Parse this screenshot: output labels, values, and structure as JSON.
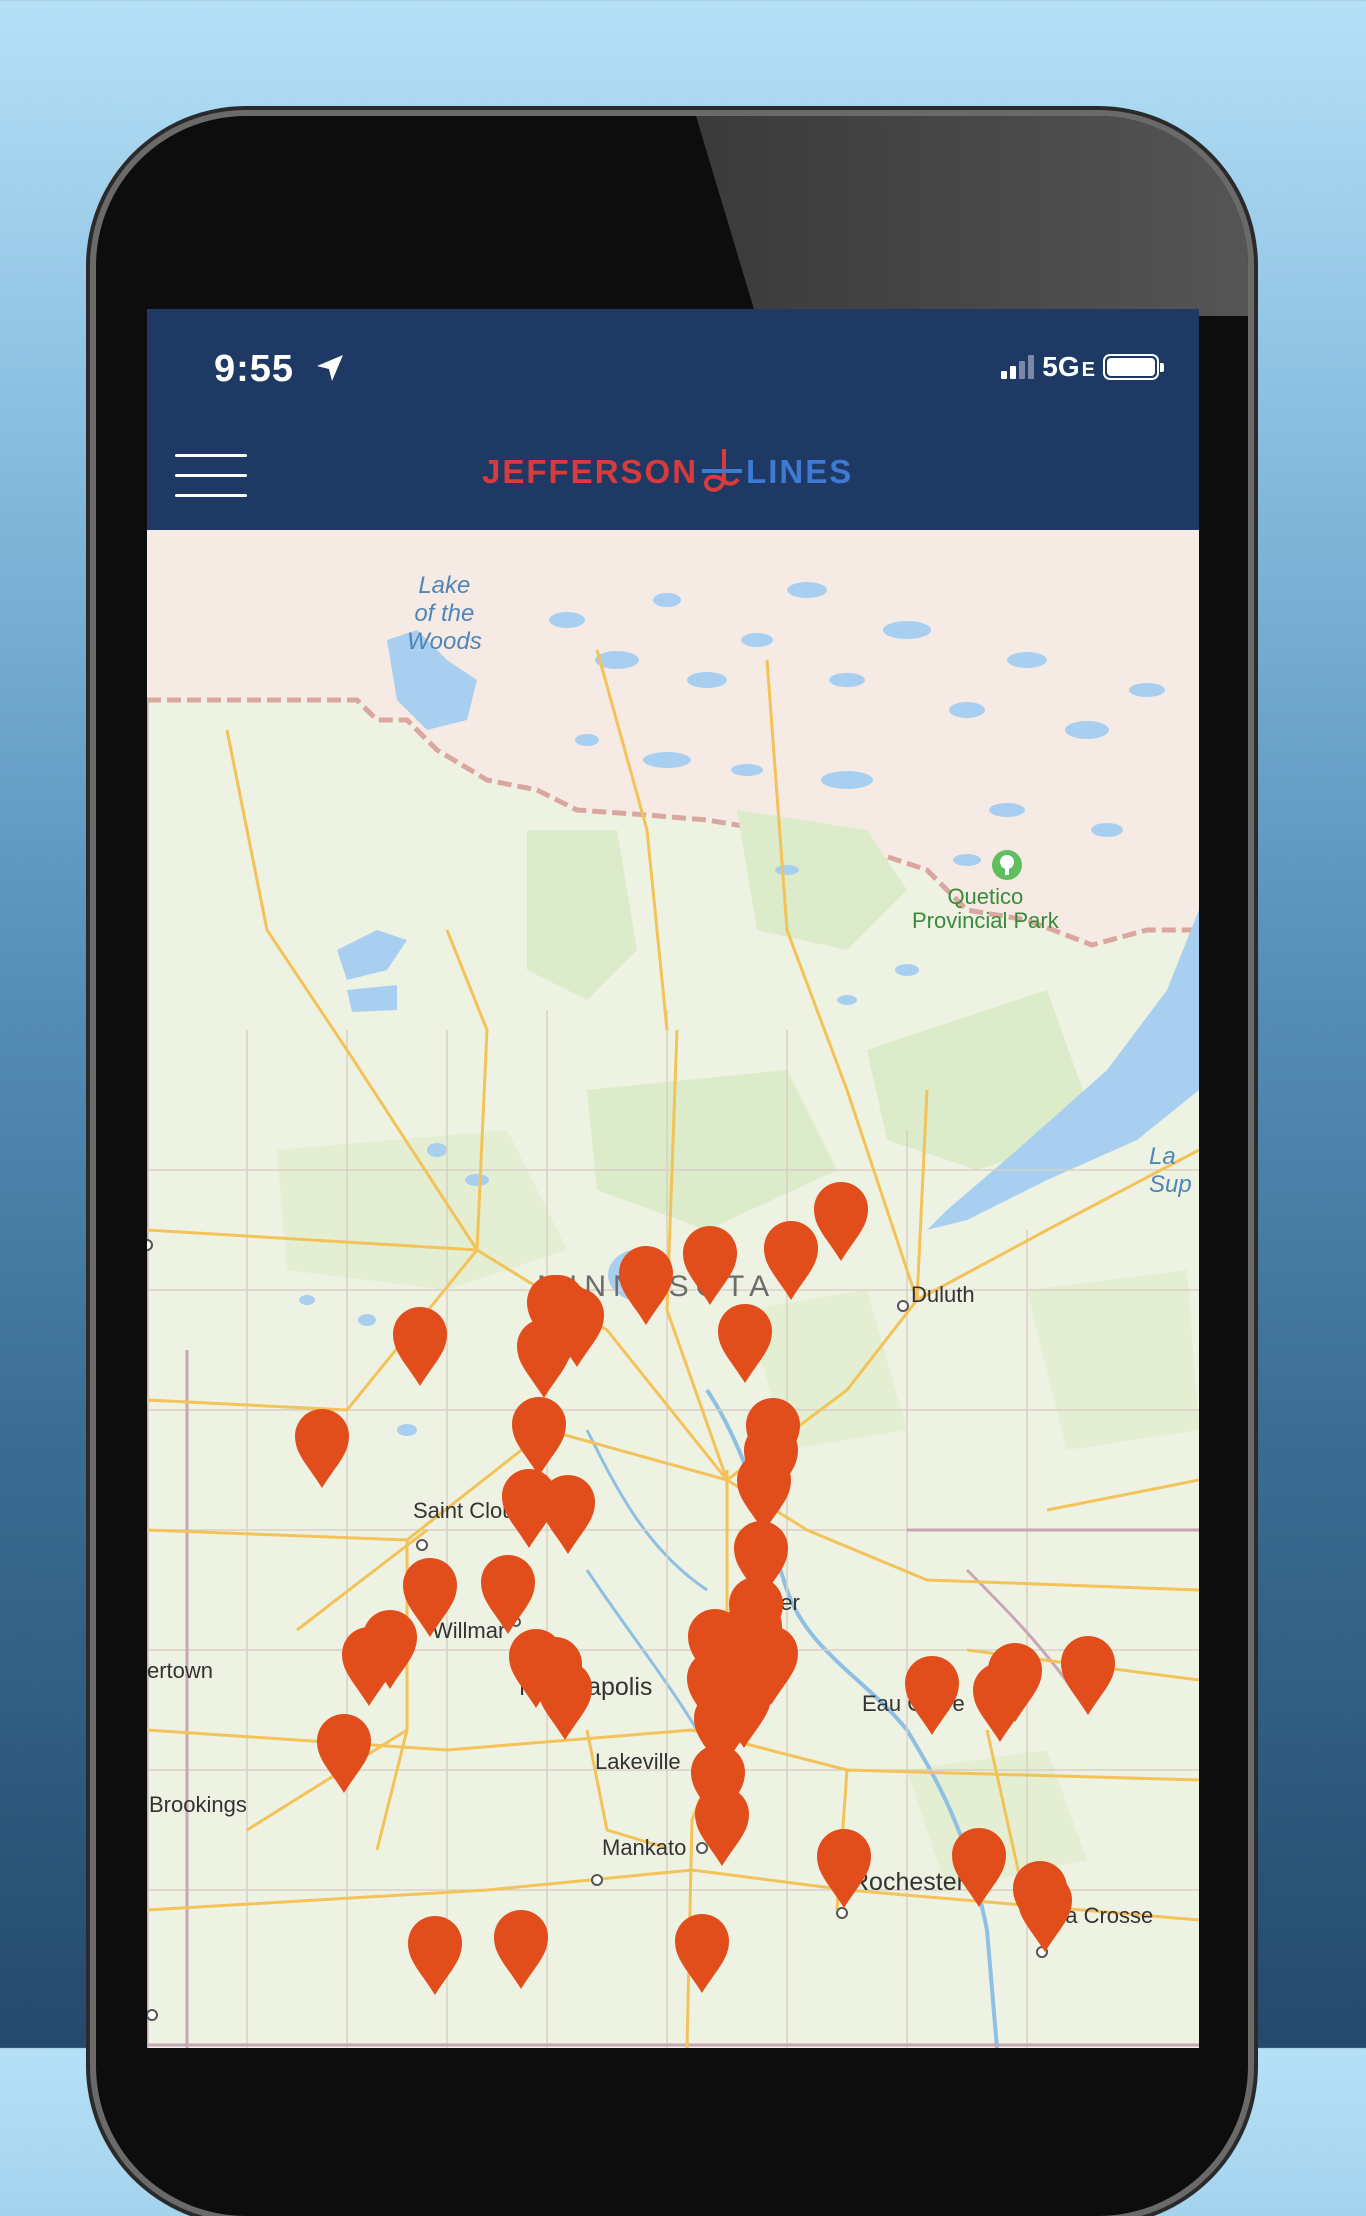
{
  "status_bar": {
    "time": "9:55",
    "network": "5G",
    "network_suffix": "E"
  },
  "header": {
    "brand_left": "JEFFERSON",
    "brand_right": "LINES"
  },
  "colors": {
    "header_bg": "#1e3a64",
    "brand_red": "#d93a3c",
    "brand_blue": "#3e7ad4",
    "pin": "#e24e1b"
  },
  "map": {
    "labels": {
      "lake_of_the_woods": "Lake\nof the\nWoods",
      "quetico": "Quetico\nProvincial Park",
      "lake_superior": "La\nSup",
      "minnesota": "MINNESOTA",
      "duluth": "Duluth",
      "saint_cloud": "Saint Cloud",
      "willmar": "Willmar",
      "watertown": "ertown",
      "minneapolis": "Minneapolis",
      "anoka": "over",
      "eau_claire": "Eau Claire",
      "lakeville": "Lakeville",
      "brookings": "Brookings",
      "mankato": "Mankato",
      "rochester": "Rochester",
      "la_crosse": "La Crosse"
    },
    "stop_pin_count": 48
  }
}
